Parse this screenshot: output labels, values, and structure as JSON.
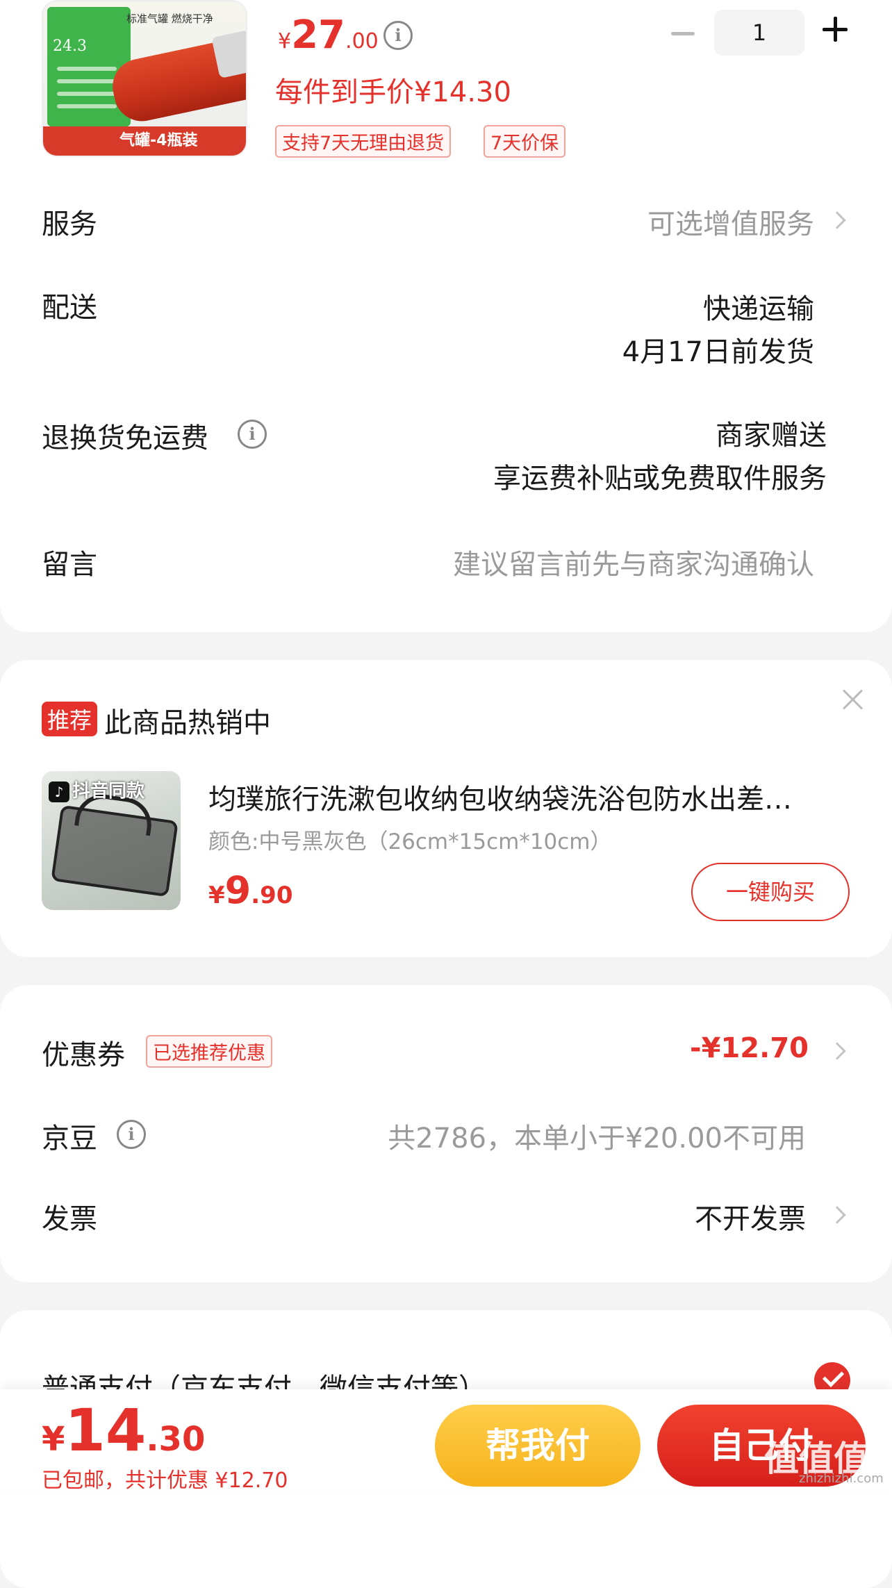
{
  "product": {
    "image_top_text": "标准气罐 燃烧干净",
    "image_number": "24.3",
    "image_banner": "气罐-4瓶装",
    "price_symbol": "¥",
    "price_int": "27",
    "price_dec": ".00",
    "per_item_price": "每件到手价¥14.30",
    "tags": [
      "支持7天无理由退货",
      "7天价保"
    ],
    "quantity": "1"
  },
  "service": {
    "label": "服务",
    "value": "可选增值服务"
  },
  "delivery": {
    "label": "配送",
    "line1": "快递运输",
    "line2": "4月17日前发货"
  },
  "return_shipping": {
    "label": "退换货免运费",
    "line1": "商家赠送",
    "line2": "享运费补贴或免费取件服务"
  },
  "message": {
    "label": "留言",
    "placeholder": "建议留言前先与商家沟通确认"
  },
  "recommend": {
    "badge": "推荐",
    "title": "此商品热销中",
    "image_tag": "抖音同款",
    "item_name": "均璞旅行洗漱包收纳包收纳袋洗浴包防水出差…",
    "item_spec": "颜色:中号黑灰色（26cm*15cm*10cm）",
    "price_symbol": "¥",
    "price_int": "9",
    "price_dec": ".90",
    "buy_label": "一键购买"
  },
  "coupon": {
    "label": "优惠券",
    "chip": "已选推荐优惠",
    "value": "-¥12.70"
  },
  "jingdou": {
    "label": "京豆",
    "value": "共2786，本单小于¥20.00不可用"
  },
  "invoice": {
    "label": "发票",
    "value": "不开发票"
  },
  "payment": {
    "label": "普通支付（京东支付、微信支付等）"
  },
  "bottom": {
    "price_symbol": "¥",
    "price_int": "14",
    "price_dec": ".30",
    "sub_text": "已包邮，共计优惠 ¥12.70",
    "help_pay": "帮我付",
    "self_pay": "自己付"
  },
  "watermark": {
    "main": "值值值",
    "sub": "zhizhizhi.com"
  },
  "colors": {
    "accent": "#e5312b",
    "help_btn": "#f6b21c"
  }
}
